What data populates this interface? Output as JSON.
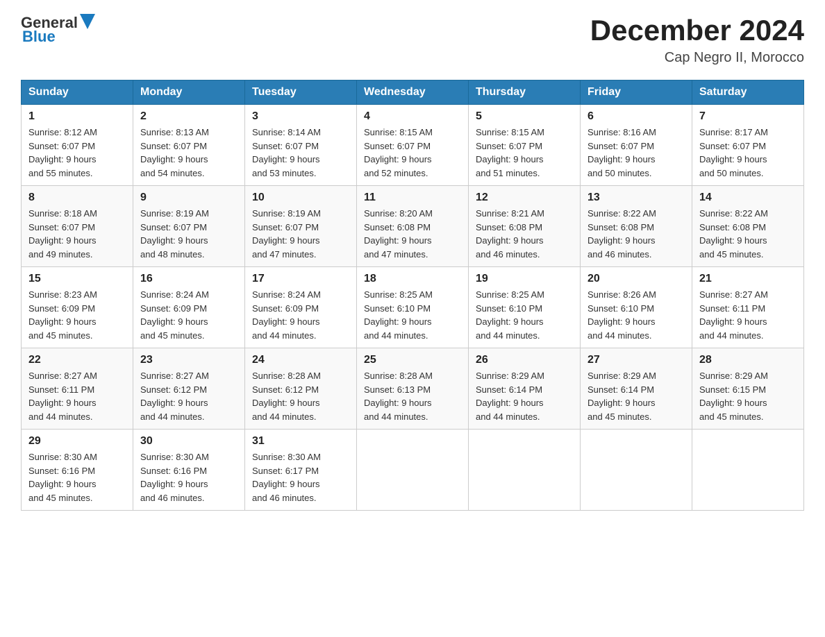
{
  "header": {
    "logo_general": "General",
    "logo_blue": "Blue",
    "month_year": "December 2024",
    "location": "Cap Negro II, Morocco"
  },
  "weekdays": [
    "Sunday",
    "Monday",
    "Tuesday",
    "Wednesday",
    "Thursday",
    "Friday",
    "Saturday"
  ],
  "weeks": [
    [
      {
        "day": "1",
        "sunrise": "8:12 AM",
        "sunset": "6:07 PM",
        "daylight": "9 hours and 55 minutes."
      },
      {
        "day": "2",
        "sunrise": "8:13 AM",
        "sunset": "6:07 PM",
        "daylight": "9 hours and 54 minutes."
      },
      {
        "day": "3",
        "sunrise": "8:14 AM",
        "sunset": "6:07 PM",
        "daylight": "9 hours and 53 minutes."
      },
      {
        "day": "4",
        "sunrise": "8:15 AM",
        "sunset": "6:07 PM",
        "daylight": "9 hours and 52 minutes."
      },
      {
        "day": "5",
        "sunrise": "8:15 AM",
        "sunset": "6:07 PM",
        "daylight": "9 hours and 51 minutes."
      },
      {
        "day": "6",
        "sunrise": "8:16 AM",
        "sunset": "6:07 PM",
        "daylight": "9 hours and 50 minutes."
      },
      {
        "day": "7",
        "sunrise": "8:17 AM",
        "sunset": "6:07 PM",
        "daylight": "9 hours and 50 minutes."
      }
    ],
    [
      {
        "day": "8",
        "sunrise": "8:18 AM",
        "sunset": "6:07 PM",
        "daylight": "9 hours and 49 minutes."
      },
      {
        "day": "9",
        "sunrise": "8:19 AM",
        "sunset": "6:07 PM",
        "daylight": "9 hours and 48 minutes."
      },
      {
        "day": "10",
        "sunrise": "8:19 AM",
        "sunset": "6:07 PM",
        "daylight": "9 hours and 47 minutes."
      },
      {
        "day": "11",
        "sunrise": "8:20 AM",
        "sunset": "6:08 PM",
        "daylight": "9 hours and 47 minutes."
      },
      {
        "day": "12",
        "sunrise": "8:21 AM",
        "sunset": "6:08 PM",
        "daylight": "9 hours and 46 minutes."
      },
      {
        "day": "13",
        "sunrise": "8:22 AM",
        "sunset": "6:08 PM",
        "daylight": "9 hours and 46 minutes."
      },
      {
        "day": "14",
        "sunrise": "8:22 AM",
        "sunset": "6:08 PM",
        "daylight": "9 hours and 45 minutes."
      }
    ],
    [
      {
        "day": "15",
        "sunrise": "8:23 AM",
        "sunset": "6:09 PM",
        "daylight": "9 hours and 45 minutes."
      },
      {
        "day": "16",
        "sunrise": "8:24 AM",
        "sunset": "6:09 PM",
        "daylight": "9 hours and 45 minutes."
      },
      {
        "day": "17",
        "sunrise": "8:24 AM",
        "sunset": "6:09 PM",
        "daylight": "9 hours and 44 minutes."
      },
      {
        "day": "18",
        "sunrise": "8:25 AM",
        "sunset": "6:10 PM",
        "daylight": "9 hours and 44 minutes."
      },
      {
        "day": "19",
        "sunrise": "8:25 AM",
        "sunset": "6:10 PM",
        "daylight": "9 hours and 44 minutes."
      },
      {
        "day": "20",
        "sunrise": "8:26 AM",
        "sunset": "6:10 PM",
        "daylight": "9 hours and 44 minutes."
      },
      {
        "day": "21",
        "sunrise": "8:27 AM",
        "sunset": "6:11 PM",
        "daylight": "9 hours and 44 minutes."
      }
    ],
    [
      {
        "day": "22",
        "sunrise": "8:27 AM",
        "sunset": "6:11 PM",
        "daylight": "9 hours and 44 minutes."
      },
      {
        "day": "23",
        "sunrise": "8:27 AM",
        "sunset": "6:12 PM",
        "daylight": "9 hours and 44 minutes."
      },
      {
        "day": "24",
        "sunrise": "8:28 AM",
        "sunset": "6:12 PM",
        "daylight": "9 hours and 44 minutes."
      },
      {
        "day": "25",
        "sunrise": "8:28 AM",
        "sunset": "6:13 PM",
        "daylight": "9 hours and 44 minutes."
      },
      {
        "day": "26",
        "sunrise": "8:29 AM",
        "sunset": "6:14 PM",
        "daylight": "9 hours and 44 minutes."
      },
      {
        "day": "27",
        "sunrise": "8:29 AM",
        "sunset": "6:14 PM",
        "daylight": "9 hours and 45 minutes."
      },
      {
        "day": "28",
        "sunrise": "8:29 AM",
        "sunset": "6:15 PM",
        "daylight": "9 hours and 45 minutes."
      }
    ],
    [
      {
        "day": "29",
        "sunrise": "8:30 AM",
        "sunset": "6:16 PM",
        "daylight": "9 hours and 45 minutes."
      },
      {
        "day": "30",
        "sunrise": "8:30 AM",
        "sunset": "6:16 PM",
        "daylight": "9 hours and 46 minutes."
      },
      {
        "day": "31",
        "sunrise": "8:30 AM",
        "sunset": "6:17 PM",
        "daylight": "9 hours and 46 minutes."
      },
      null,
      null,
      null,
      null
    ]
  ]
}
